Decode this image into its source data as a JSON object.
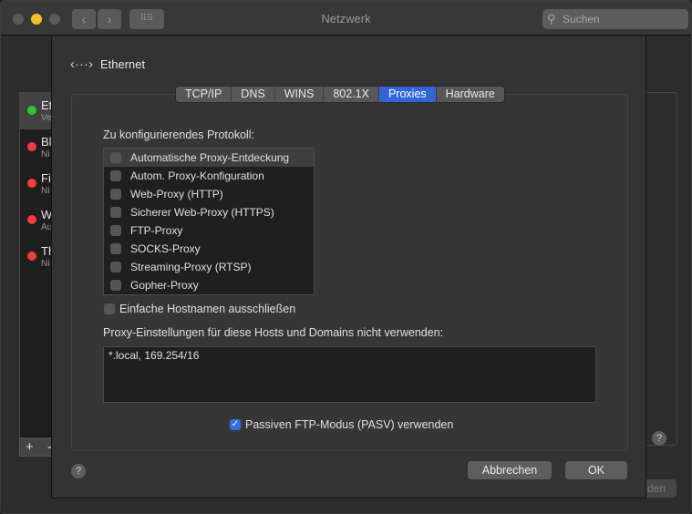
{
  "window": {
    "title": "Netzwerk",
    "search_placeholder": "Suchen"
  },
  "sidebar": {
    "items": [
      {
        "name": "Et",
        "sub": "Ve",
        "status": "green"
      },
      {
        "name": "Bl",
        "sub": "Ni",
        "status": "red"
      },
      {
        "name": "Fi",
        "sub": "Ni",
        "status": "red"
      },
      {
        "name": "W",
        "sub": "Au",
        "status": "red"
      },
      {
        "name": "Th",
        "sub": "Ni",
        "status": "red"
      }
    ],
    "add": "+",
    "remove": "-"
  },
  "background": {
    "button_partial": "den",
    "help": "?"
  },
  "sheet": {
    "service": "Ethernet",
    "tabs": [
      "TCP/IP",
      "DNS",
      "WINS",
      "802.1X",
      "Proxies",
      "Hardware"
    ],
    "active_tab": "Proxies",
    "protocol_label": "Zu konfigurierendes Protokoll:",
    "protocols": [
      {
        "label": "Automatische Proxy-Entdeckung",
        "checked": false
      },
      {
        "label": "Autom. Proxy-Konfiguration",
        "checked": false
      },
      {
        "label": "Web-Proxy (HTTP)",
        "checked": false
      },
      {
        "label": "Sicherer Web-Proxy (HTTPS)",
        "checked": false
      },
      {
        "label": "FTP-Proxy",
        "checked": false
      },
      {
        "label": "SOCKS-Proxy",
        "checked": false
      },
      {
        "label": "Streaming-Proxy (RTSP)",
        "checked": false
      },
      {
        "label": "Gopher-Proxy",
        "checked": false
      }
    ],
    "exclude_simple": {
      "label": "Einfache Hostnamen ausschließen",
      "checked": false
    },
    "bypass_label": "Proxy-Einstellungen für diese Hosts und Domains nicht verwenden:",
    "bypass_value": "*.local, 169.254/16",
    "pasv": {
      "label": "Passiven FTP-Modus (PASV) verwenden",
      "checked": true
    },
    "help": "?",
    "cancel": "Abbrechen",
    "ok": "OK"
  },
  "colors": {
    "accent": "#3465d8",
    "green": "#2fc33a",
    "red": "#f03e3e",
    "yellow": "#f5be2a"
  }
}
